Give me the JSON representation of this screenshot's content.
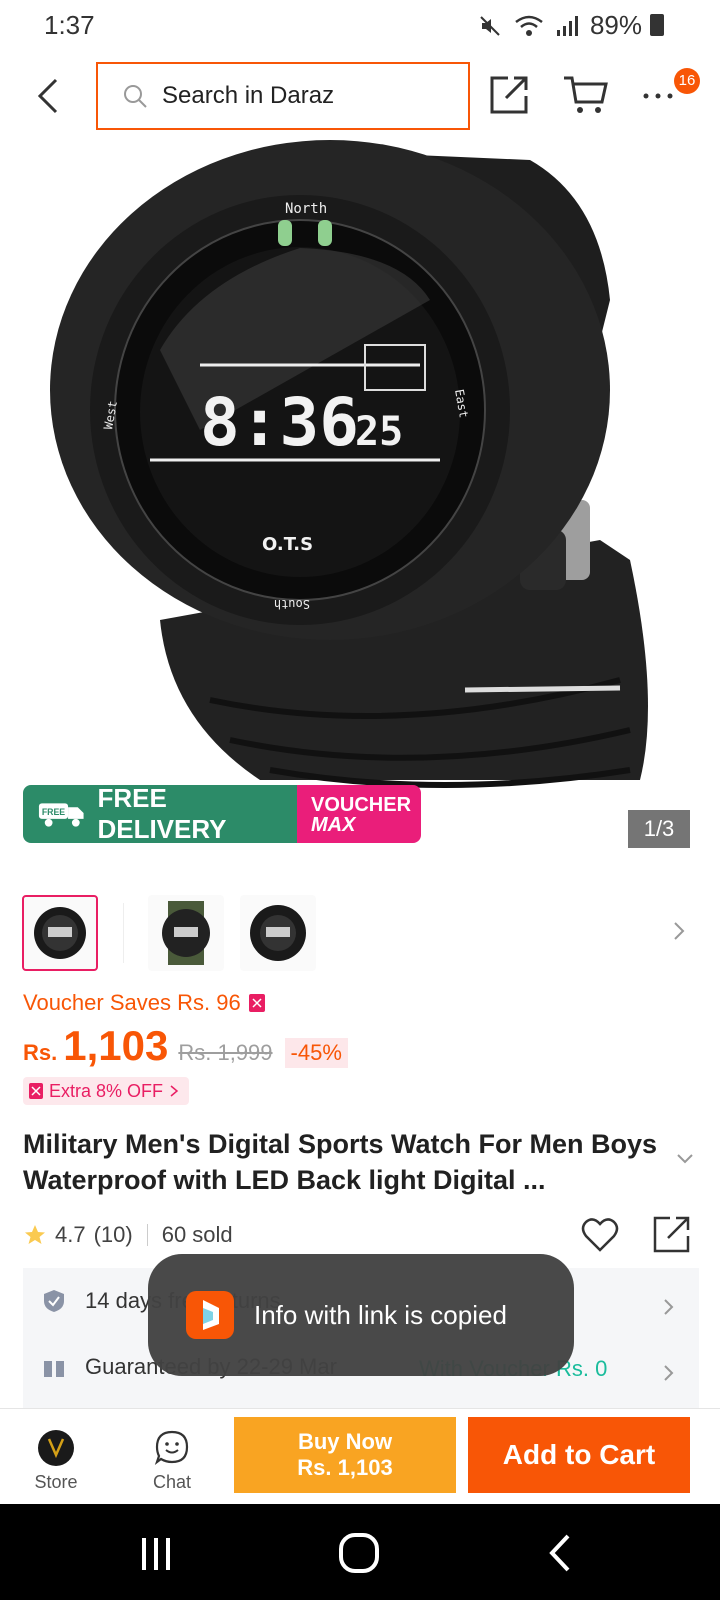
{
  "status_bar": {
    "time": "1:37",
    "battery": "89%"
  },
  "header": {
    "search_placeholder": "Search in Daraz",
    "more_badge": "16"
  },
  "gallery": {
    "free_delivery_tag": "FREE",
    "free_delivery": "FREE DELIVERY",
    "voucher_line1": "VOUCHER",
    "voucher_line2": "MAX",
    "counter": "1/3"
  },
  "watch_face": {
    "north": "North",
    "south": "South",
    "east": "East",
    "west": "West",
    "time": "8:36",
    "seconds": "25",
    "brand": "O.T.S"
  },
  "pricing": {
    "voucher_saves": "Voucher Saves Rs. 96",
    "currency": "Rs.",
    "price": "1,103",
    "original_price": "Rs. 1,999",
    "discount": "-45%",
    "extra_off": "Extra 8% OFF"
  },
  "product": {
    "title": "Military Men's Digital Sports Watch For Men Boys Waterproof with LED Back light Digital ...",
    "rating": "4.7",
    "rating_count": "(10)",
    "sold": "60 sold"
  },
  "info": {
    "returns_text": "14 days free returns",
    "guarantee_text": "Guaranteed by 22-29 Mar",
    "voucher_delivery": "With Voucher Rs. 0"
  },
  "toast": {
    "message": "Info with link is copied"
  },
  "bottom_bar": {
    "store_label": "Store",
    "chat_label": "Chat",
    "buy_now_line1": "Buy Now",
    "buy_now_line2": "Rs. 1,103",
    "add_to_cart": "Add to Cart"
  },
  "colors": {
    "accent": "#f85606",
    "buy_now": "#f9a422",
    "voucher_pink": "#ea1e7a",
    "free_green": "#2c8b68",
    "teal": "#1abc9c"
  }
}
